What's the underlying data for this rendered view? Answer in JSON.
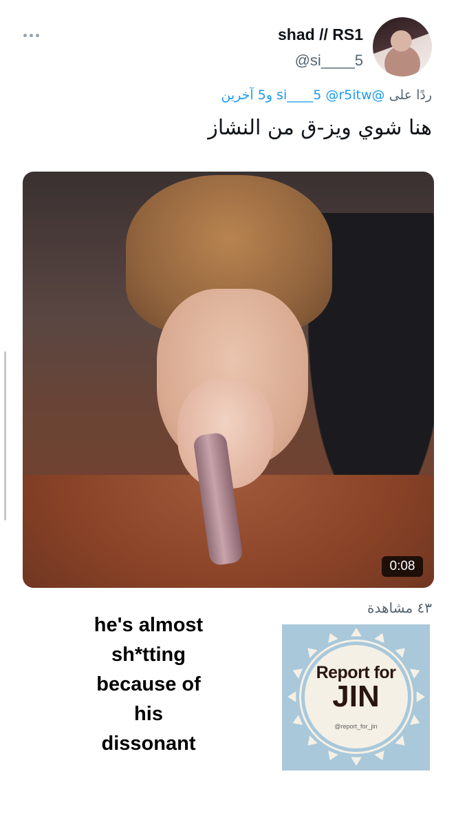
{
  "tweet": {
    "display_name": "shad // RS1",
    "handle": "@si____5",
    "reply_prefix": "ردًا على",
    "reply_mentions": "@si____5 @r5itw",
    "reply_suffix": "و5 آخرين",
    "text": "هنا شوي ويز-ق من النشاز",
    "video_duration": "0:08",
    "views": "٤٣ مشاهدة"
  },
  "caption": {
    "lines": [
      "he's almost",
      "sh*tting",
      "because of",
      "his",
      "dissonant"
    ]
  },
  "logo": {
    "line1": "Report for",
    "line2": "JIN",
    "account": "@report_for_jin"
  },
  "icons": {
    "more": "more-options-icon"
  }
}
